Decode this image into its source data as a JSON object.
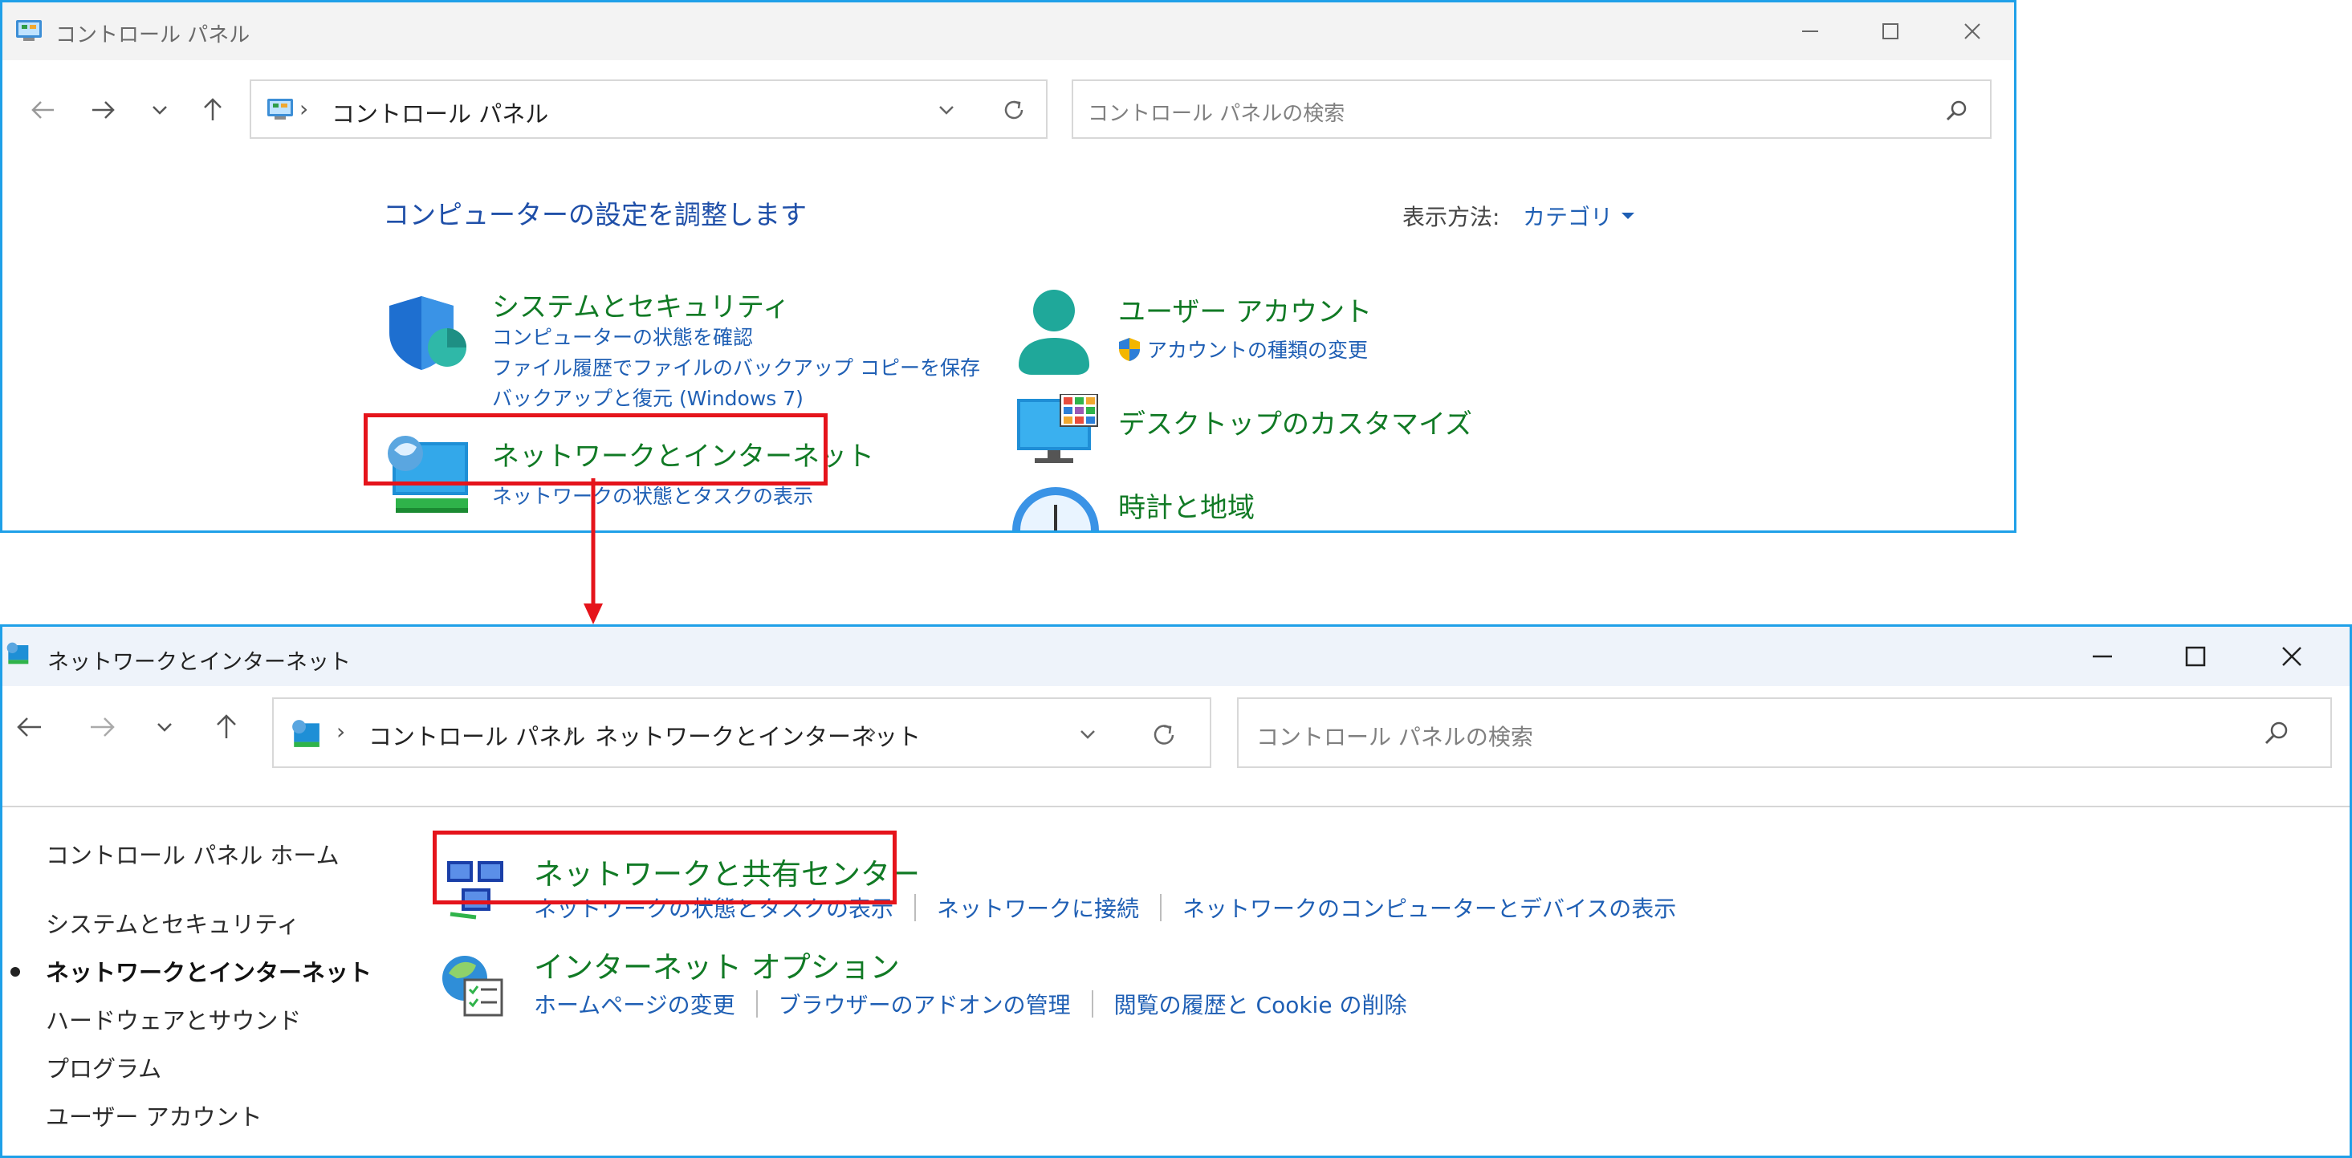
{
  "window1": {
    "title": "コントロール パネル",
    "address": {
      "crumbs": [
        "コントロール パネル"
      ]
    },
    "search": {
      "placeholder": "コントロール パネルの検索"
    },
    "heading": "コンピューターの設定を調整します",
    "view_by": {
      "label": "表示方法:",
      "value": "カテゴリ"
    },
    "categories": {
      "system_security": {
        "title": "システムとセキュリティ",
        "links": [
          "コンピューターの状態を確認",
          "ファイル履歴でファイルのバックアップ コピーを保存",
          "バックアップと復元 (Windows 7)"
        ]
      },
      "network_internet": {
        "title": "ネットワークとインターネット",
        "links": [
          "ネットワークの状態とタスクの表示"
        ]
      },
      "user_accounts": {
        "title": "ユーザー アカウント",
        "links": [
          "アカウントの種類の変更"
        ]
      },
      "desktop_customize": {
        "title": "デスクトップのカスタマイズ"
      },
      "clock_region": {
        "title": "時計と地域"
      }
    }
  },
  "window2": {
    "title": "ネットワークとインターネット",
    "address": {
      "crumbs": [
        "コントロール パネル",
        "ネットワークとインターネット"
      ]
    },
    "search": {
      "placeholder": "コントロール パネルの検索"
    },
    "sidebar": {
      "home": "コントロール パネル ホーム",
      "items": [
        "システムとセキュリティ",
        "ネットワークとインターネット",
        "ハードウェアとサウンド",
        "プログラム",
        "ユーザー アカウント"
      ],
      "current_index": 1
    },
    "sections": {
      "sharing_center": {
        "title": "ネットワークと共有センター",
        "links": [
          "ネットワークの状態とタスクの表示",
          "ネットワークに接続",
          "ネットワークのコンピューターとデバイスの表示"
        ]
      },
      "internet_options": {
        "title": "インターネット オプション",
        "links": [
          "ホームページの変更",
          "ブラウザーのアドオンの管理",
          "閲覧の履歴と Cookie の削除"
        ]
      }
    }
  },
  "colors": {
    "highlight_box": "#e5141b",
    "link": "#1f5fb4",
    "category_title": "#117a25",
    "window_border": "#1fa0e8"
  }
}
